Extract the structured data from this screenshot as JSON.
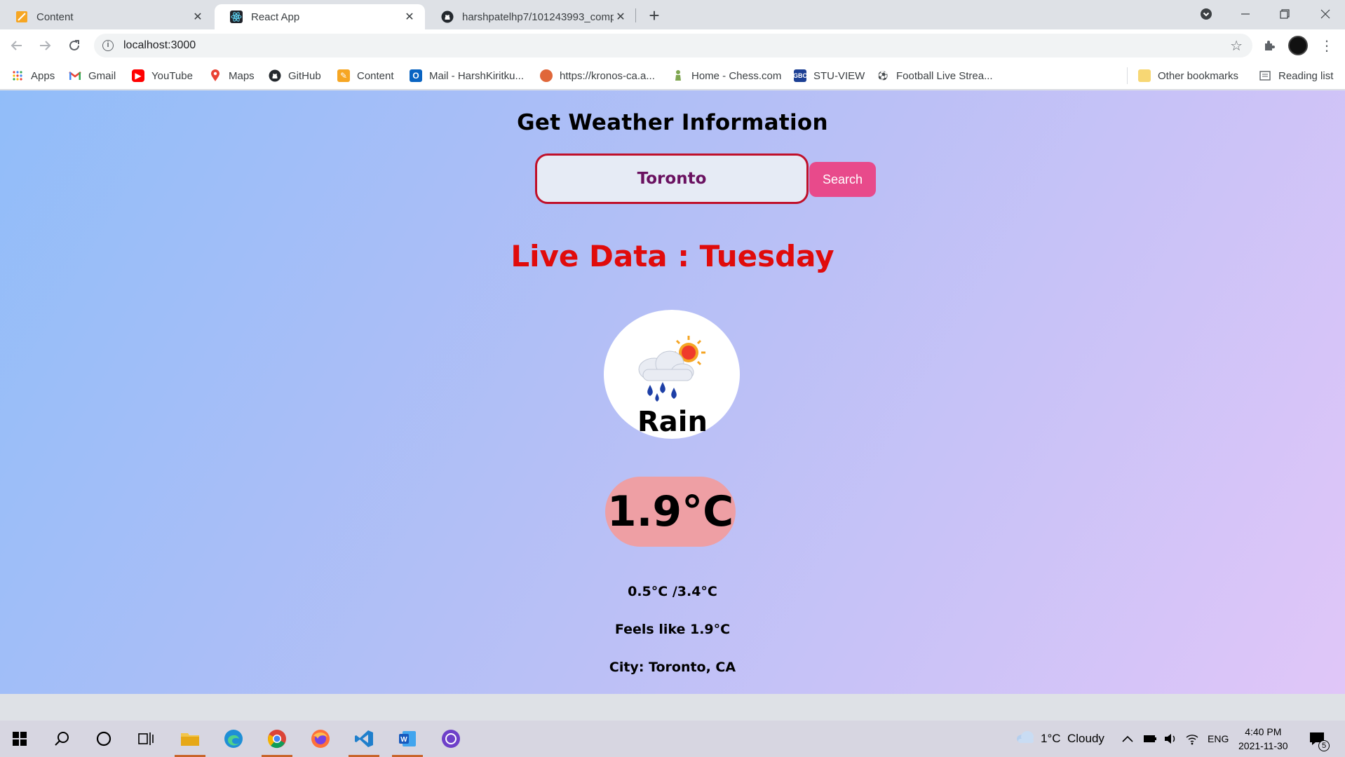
{
  "browser": {
    "tabs": [
      {
        "title": "Content",
        "icon": "notes-icon",
        "active": false
      },
      {
        "title": "React App",
        "icon": "react-icon",
        "active": true
      },
      {
        "title": "harshpatelhp7/101243993_comp",
        "icon": "github-icon",
        "active": false
      }
    ],
    "url": "localhost:3000",
    "bookmarks": [
      {
        "label": "Apps",
        "icon": "apps-grid-icon"
      },
      {
        "label": "Gmail",
        "icon": "gmail-icon"
      },
      {
        "label": "YouTube",
        "icon": "youtube-icon"
      },
      {
        "label": "Maps",
        "icon": "maps-icon"
      },
      {
        "label": "GitHub",
        "icon": "github-icon"
      },
      {
        "label": "Content",
        "icon": "notes-icon"
      },
      {
        "label": "Mail - HarshKiritku...",
        "icon": "outlook-icon"
      },
      {
        "label": "https://kronos-ca.a...",
        "icon": "kronos-icon"
      },
      {
        "label": "Home - Chess.com",
        "icon": "chess-icon"
      },
      {
        "label": "STU-VIEW",
        "icon": "gbc-icon"
      },
      {
        "label": "Football Live Strea...",
        "icon": "football-icon"
      }
    ],
    "other_bookmarks": "Other bookmarks",
    "reading_list": "Reading list"
  },
  "app": {
    "title": "Get Weather Information",
    "search": {
      "value": "Toronto",
      "button_label": "Search"
    },
    "live_data": "Live Data : Tuesday",
    "condition": "Rain",
    "temperature": "1.9°C",
    "min_max": "0.5°C /3.4°C",
    "feels_like": "Feels like 1.9°C",
    "city": "City: Toronto, CA"
  },
  "taskbar": {
    "weather": "1°C  Cloudy",
    "language": "ENG",
    "time": "4:40 PM",
    "date": "2021-11-30",
    "notification_count": "5"
  },
  "colors": {
    "accent_pink": "#e84a8b",
    "live_data_red": "#e00b0b",
    "temp_pill": "#ee9fa4",
    "input_border": "#c0102a"
  }
}
